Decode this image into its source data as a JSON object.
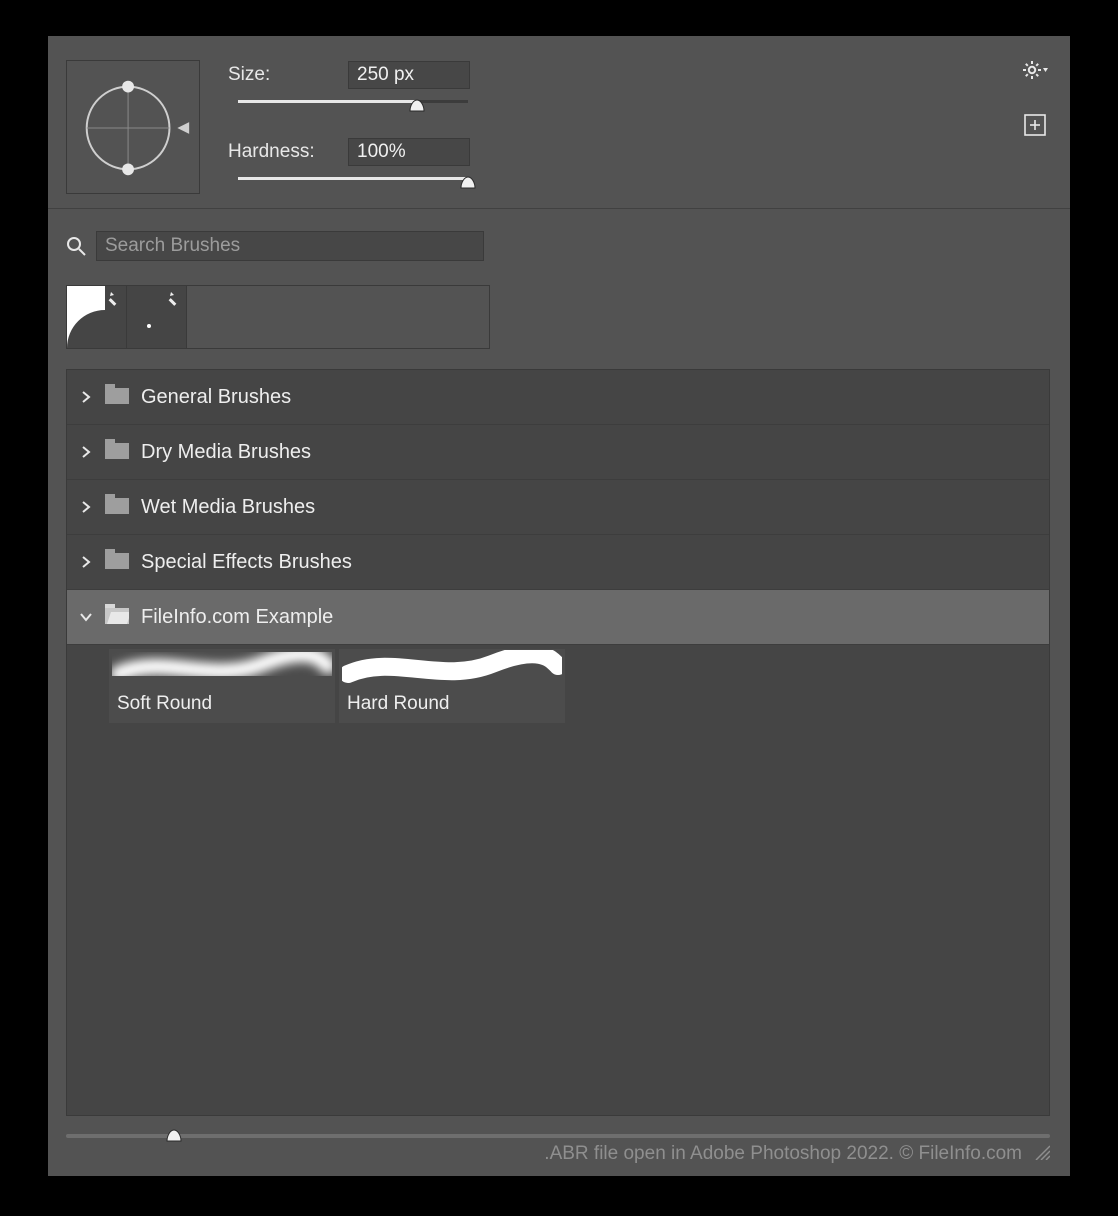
{
  "top": {
    "size_label": "Size:",
    "size_value": "250 px",
    "size_slider_pct": 78,
    "hardness_label": "Hardness:",
    "hardness_value": "100%",
    "hardness_slider_pct": 100
  },
  "search": {
    "placeholder": "Search Brushes"
  },
  "folders": [
    {
      "label": "General Brushes",
      "expanded": false,
      "selected": false
    },
    {
      "label": "Dry Media Brushes",
      "expanded": false,
      "selected": false
    },
    {
      "label": "Wet Media Brushes",
      "expanded": false,
      "selected": false
    },
    {
      "label": "Special Effects Brushes",
      "expanded": false,
      "selected": false
    },
    {
      "label": "FileInfo.com Example",
      "expanded": true,
      "selected": true
    }
  ],
  "brushes": [
    {
      "name": "Soft Round",
      "style": "soft"
    },
    {
      "name": "Hard Round",
      "style": "hard"
    }
  ],
  "footer": {
    "caption": ".ABR file open in Adobe Photoshop 2022. © FileInfo.com",
    "zoom_slider_pct": 11
  },
  "icons": {
    "gear": "gear-icon",
    "plus": "new-preset-icon",
    "search": "search-icon",
    "resize": "resize-handle-icon"
  }
}
